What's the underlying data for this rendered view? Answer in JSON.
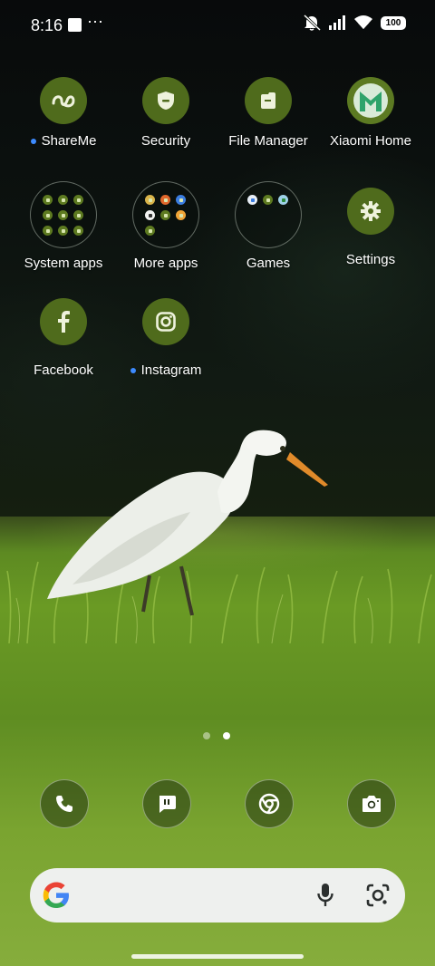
{
  "status_bar": {
    "time": "8:16",
    "more_glyph": "⋯",
    "battery": "100",
    "icons": [
      "notification-box-icon",
      "mute-icon",
      "signal-icon",
      "wifi-icon",
      "battery-icon"
    ]
  },
  "apps": [
    {
      "label": "ShareMe",
      "icon": "shareme-icon",
      "new": true
    },
    {
      "label": "Security",
      "icon": "shield-icon",
      "new": false
    },
    {
      "label": "File Manager",
      "icon": "folder-file-icon",
      "new": false
    },
    {
      "label": "Xiaomi Home",
      "icon": "xiaomi-home-icon",
      "new": false
    },
    {
      "label": "System apps",
      "icon": "folder-icon",
      "new": false
    },
    {
      "label": "More apps",
      "icon": "folder-icon",
      "new": false
    },
    {
      "label": "Games",
      "icon": "folder-icon",
      "new": false
    },
    {
      "label": "Settings",
      "icon": "gear-icon",
      "new": false
    },
    {
      "label": "Facebook",
      "icon": "facebook-icon",
      "new": false
    },
    {
      "label": "Instagram",
      "icon": "instagram-icon",
      "new": true
    }
  ],
  "page_indicator": {
    "pages": 2,
    "active": 2
  },
  "dock": [
    {
      "icon": "phone-icon"
    },
    {
      "icon": "messages-icon"
    },
    {
      "icon": "chrome-icon"
    },
    {
      "icon": "camera-icon"
    }
  ],
  "search_bar": {
    "logo": "google-g-icon",
    "mic": "microphone-icon",
    "lens": "google-lens-icon"
  },
  "colors": {
    "icon_bg": "#4f6b1c",
    "icon_glyph": "#eef2dc",
    "new_dot": "#3d8bff"
  }
}
